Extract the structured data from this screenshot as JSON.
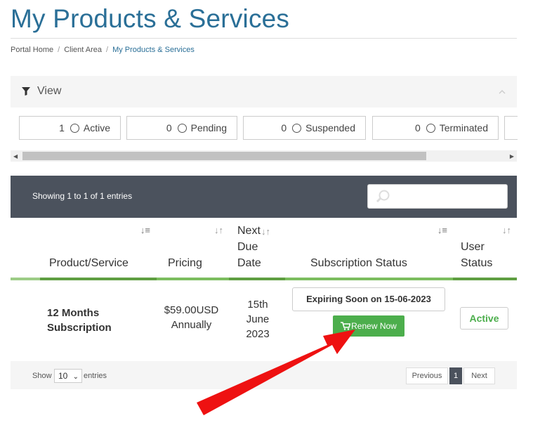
{
  "page": {
    "title": "My Products & Services",
    "breadcrumb": [
      "Portal Home",
      "Client Area",
      "My Products & Services"
    ]
  },
  "view_panel": {
    "label": "View"
  },
  "filters": [
    {
      "count": "1",
      "label": "Active"
    },
    {
      "count": "0",
      "label": "Pending"
    },
    {
      "count": "0",
      "label": "Suspended"
    },
    {
      "count": "0",
      "label": "Terminated"
    }
  ],
  "table": {
    "showing": "Showing 1 to 1 of 1 entries",
    "columns": {
      "product": "Product/Service",
      "pricing": "Pricing",
      "due_line1": "Next",
      "due_line2": "Due",
      "due_line3": "Date",
      "subscription": "Subscription Status",
      "user_line1": "User",
      "user_line2": "Status"
    },
    "row": {
      "product_line1": "12 Months",
      "product_line2": "Subscription",
      "price_line1": "$59.00USD",
      "price_line2": "Annually",
      "due_line1": "15th",
      "due_line2": "June",
      "due_line3": "2023",
      "subscription_status": "Expiring Soon on 15-06-2023",
      "renew_label": "Renew Now",
      "user_status": "Active"
    }
  },
  "footer": {
    "show_label": "Show",
    "page_size": "10",
    "entries_label": "entries",
    "previous": "Previous",
    "current_page": "1",
    "next": "Next"
  },
  "colors": {
    "title": "#2a6f97",
    "header_bar": "#4b525d",
    "accent_green": "#4cae4c",
    "annotation_arrow": "#ee1111"
  }
}
